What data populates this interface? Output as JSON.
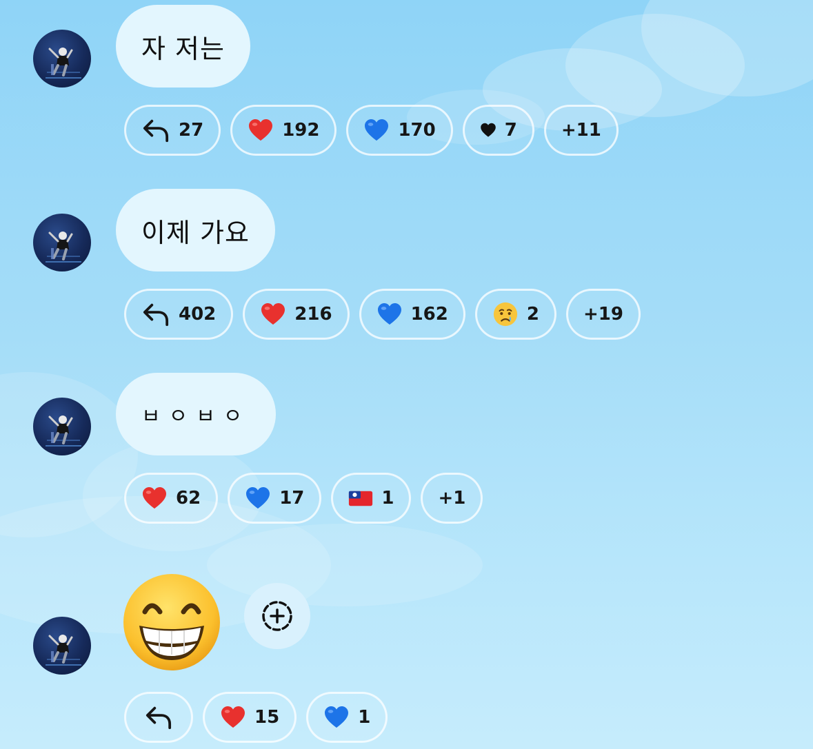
{
  "messages": [
    {
      "text": "자 저는",
      "reply_count": "27",
      "reactions": [
        {
          "icon": "red-heart",
          "emoji": "❤️",
          "count": "192"
        },
        {
          "icon": "blue-heart",
          "emoji": "💙",
          "count": "170"
        },
        {
          "icon": "black-heart",
          "emoji": "♥",
          "count": "7"
        }
      ],
      "more": "+11"
    },
    {
      "text": "이제 가요",
      "reply_count": "402",
      "reactions": [
        {
          "icon": "red-heart",
          "emoji": "❤️",
          "count": "216"
        },
        {
          "icon": "blue-heart",
          "emoji": "💙",
          "count": "162"
        },
        {
          "icon": "crying-face",
          "emoji": "😢",
          "count": "2"
        }
      ],
      "more": "+19"
    },
    {
      "text": "ㅂㅇㅂㅇ",
      "reactions": [
        {
          "icon": "red-heart",
          "emoji": "❤️",
          "count": "62"
        },
        {
          "icon": "blue-heart",
          "emoji": "💙",
          "count": "17"
        },
        {
          "icon": "taiwan-flag",
          "emoji": "🇹🇼",
          "count": "1"
        }
      ],
      "more": "+1"
    },
    {
      "emoji_message": "😁",
      "reactions": [
        {
          "icon": "red-heart",
          "emoji": "❤️",
          "count": "15"
        },
        {
          "icon": "blue-heart",
          "emoji": "💙",
          "count": "1"
        }
      ]
    }
  ],
  "colors": {
    "bubble": "#e3f6fe",
    "red_heart": "#e8312e",
    "blue_heart": "#1d74e8",
    "sky_top": "#8fd4f7",
    "sky_bottom": "#c6ecfc"
  }
}
